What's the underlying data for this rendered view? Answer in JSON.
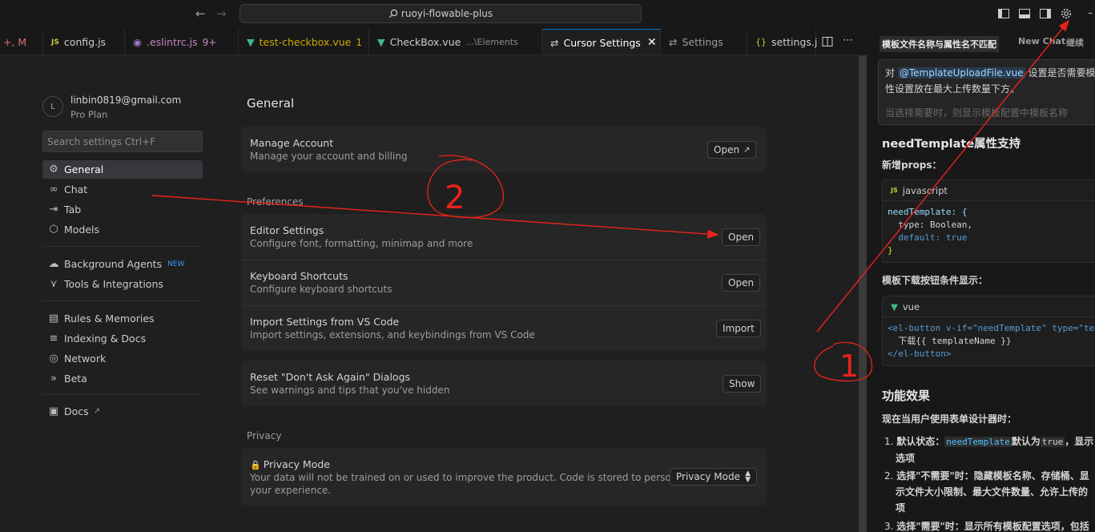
{
  "titlebar": {
    "search_text": "ruoyi-flowable-plus"
  },
  "tabs": [
    {
      "label": "+, M",
      "color": "#e06c75"
    },
    {
      "label": "config.js",
      "icon": "JS",
      "color": "#cccccc"
    },
    {
      "label": ".eslintrc.js",
      "badge": "9+",
      "color": "#c586c0"
    },
    {
      "label": "test-checkbox.vue",
      "badge": "1",
      "color": "#cca700"
    },
    {
      "label": "CheckBox.vue",
      "desc": "...\\Elements",
      "color": "#cccccc"
    },
    {
      "label": "Cursor Settings",
      "active": true
    },
    {
      "label": "Settings"
    },
    {
      "label": "settings.j",
      "icon": "{}"
    }
  ],
  "sidebar": {
    "avatar_letter": "L",
    "email": "linbin0819@gmail.com",
    "plan": "Pro Plan",
    "search_placeholder": "Search settings Ctrl+F",
    "items": [
      {
        "label": "General",
        "icon": "gear-icon"
      },
      {
        "label": "Chat",
        "icon": "infinity-icon"
      },
      {
        "label": "Tab",
        "icon": "tab-arrow-icon"
      },
      {
        "label": "Models",
        "icon": "cube-icon"
      },
      {
        "label": "Background Agents",
        "icon": "cloud-icon",
        "badge": "NEW"
      },
      {
        "label": "Tools & Integrations",
        "icon": "nodes-icon"
      },
      {
        "label": "Rules & Memories",
        "icon": "clipboard-icon"
      },
      {
        "label": "Indexing & Docs",
        "icon": "database-icon"
      },
      {
        "label": "Network",
        "icon": "globe-icon"
      },
      {
        "label": "Beta",
        "icon": "chevrons-icon"
      },
      {
        "label": "Docs",
        "icon": "book-icon"
      }
    ]
  },
  "main": {
    "heading": "General",
    "account": {
      "title": "Manage Account",
      "desc": "Manage your account and billing",
      "button": "Open"
    },
    "preferences_label": "Preferences",
    "preferences": [
      {
        "title": "Editor Settings",
        "desc": "Configure font, formatting, minimap and more",
        "button": "Open"
      },
      {
        "title": "Keyboard Shortcuts",
        "desc": "Configure keyboard shortcuts",
        "button": "Open"
      },
      {
        "title": "Import Settings from VS Code",
        "desc": "Import settings, extensions, and keybindings from VS Code",
        "button": "Import"
      }
    ],
    "reset": {
      "title": "Reset \"Don't Ask Again\" Dialogs",
      "desc": "See warnings and tips that you've hidden",
      "button": "Show"
    },
    "privacy_label": "Privacy",
    "privacy": {
      "title": "Privacy Mode",
      "desc_line1": "Your data will not be trained on or used to improve the product. Code is stored to personalize",
      "desc_line2": "your experience.",
      "select_value": "Privacy Mode"
    }
  },
  "chat": {
    "tabs": [
      "模板文件名称与属性名不匹配",
      "New Chat",
      "继续"
    ],
    "prompt_prefix": "对",
    "prompt_mention": "@TemplateUploadFile.vue",
    "prompt_rest": "设置是否需要模",
    "prompt_line2": "性设置放在最大上传数量下方。",
    "prompt_faded": "当选择需要时，则显示模板配置中模板名称",
    "h_needtemplate": "needTemplate属性支持",
    "new_props_label": "新增props：",
    "code1_lang": "javascript",
    "code1_line1": "needTemplate: {",
    "code1_line2": "  type: Boolean,",
    "code1_line3": "  default: true",
    "code1_line4": "}",
    "download_label": "模板下载按钮条件显示：",
    "code2_lang": "vue",
    "code2_line1": "<el-button v-if=\"needTemplate\" type=\"te",
    "code2_line2": "  下载{{ templateName }}",
    "code2_line3": "</el-button>",
    "h_effect": "功能效果",
    "effect_intro": "现在当用户使用表单设计器时：",
    "list": [
      {
        "num": "1.",
        "bold": "默认状态：",
        "code": "needTemplate",
        "rest": "默认为",
        "code2": "true",
        "rest2": "，显示",
        "line2": "选项"
      },
      {
        "num": "2.",
        "bold": "选择\"不需要\"时：",
        "rest": "隐藏模板名称、存储桶、显",
        "line2": "示文件大小限制、最大文件数量、允许上传的",
        "line3": "项"
      },
      {
        "num": "3.",
        "bold": "选择\"需要\"时：",
        "rest": "显示所有模板配置选项，包括"
      }
    ]
  },
  "annotations": {
    "label_1": "1",
    "label_2": "2",
    "color": "#e8231a"
  }
}
